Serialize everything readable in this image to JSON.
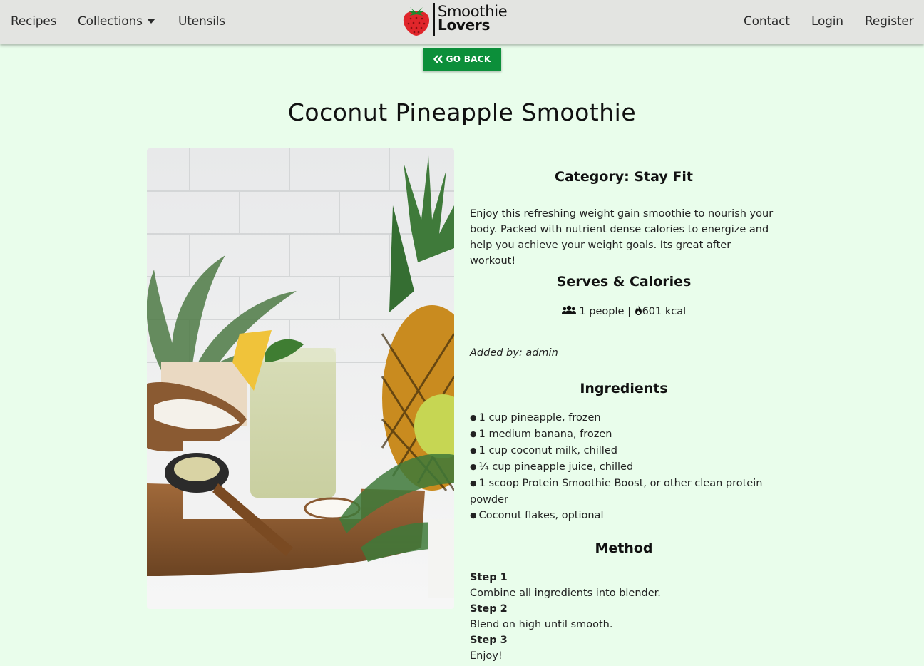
{
  "nav": {
    "left_links": [
      "Recipes",
      "Collections",
      "Utensils"
    ],
    "right_links": [
      "Contact",
      "Login",
      "Register"
    ],
    "logo_line1": "Smoothie",
    "logo_line2": "Lovers"
  },
  "go_back_label": "GO BACK",
  "recipe": {
    "title": "Coconut Pineapple Smoothie",
    "category": "Category: Stay Fit",
    "description": "Enjoy this refreshing weight gain smoothie to nourish your body. Packed with nutrient dense calories to energize and help you achieve your weight goals. Its great after workout!",
    "serves_heading": "Serves & Calories",
    "serves": "1 people",
    "separator": "|",
    "calories": "601 kcal",
    "added_by": "Added by: admin",
    "ingredients_heading": "Ingredients",
    "ingredients": [
      "1 cup pineapple, frozen",
      "1 medium banana, frozen",
      "1 cup coconut milk, chilled",
      "¼ cup pineapple juice, chilled",
      "1 scoop Protein Smoothie Boost, or other clean protein powder",
      "Coconut flakes, optional"
    ],
    "method_heading": "Method",
    "steps": [
      {
        "label": "Step 1",
        "text": "Combine all ingredients into blender."
      },
      {
        "label": "Step 2",
        "text": "Blend on high until smooth."
      },
      {
        "label": "Step 3",
        "text": "Enjoy!"
      }
    ]
  },
  "colors": {
    "page_background": "#e9fdeb",
    "navbar_background": "#e3e4e1",
    "button_green": "#0c8f3a",
    "strawberry_red": "#e0262b"
  },
  "icons": [
    "strawberry-logo-icon",
    "caret-down-icon",
    "double-chevron-left-icon",
    "users-icon",
    "fire-icon"
  ]
}
